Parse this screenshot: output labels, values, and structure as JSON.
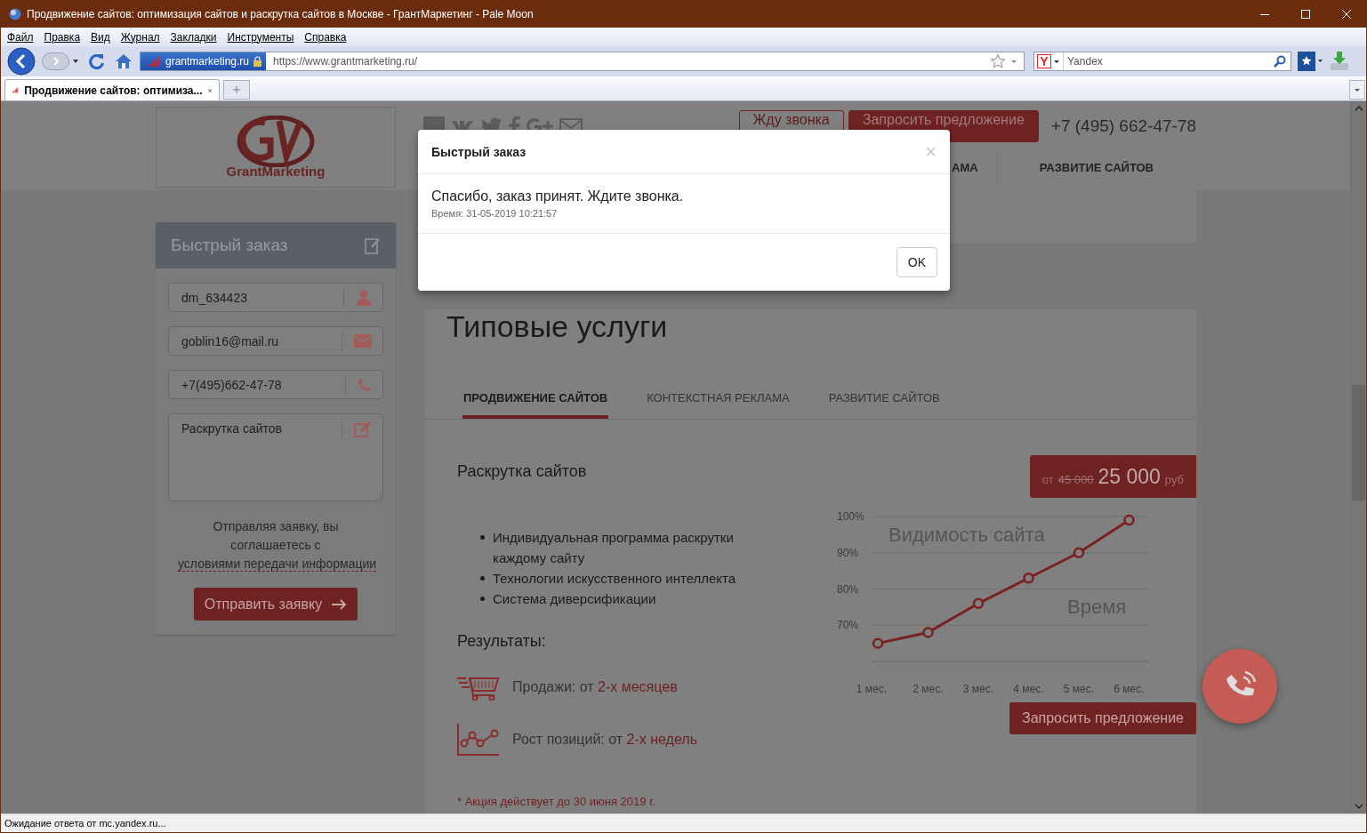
{
  "window": {
    "title": "Продвижение сайтов: оптимизация сайтов и раскрутка сайтов в Москве - ГрантМаркетинг - Pale Moon"
  },
  "menu": [
    "Файл",
    "Правка",
    "Вид",
    "Журнал",
    "Закладки",
    "Инструменты",
    "Справка"
  ],
  "navbar": {
    "identity": "grantmarketing.ru",
    "url": "https://www.grantmarketing.ru/",
    "search": {
      "placeholder": "Yandex"
    }
  },
  "tabs": [
    {
      "label": "Продвижение сайтов: оптимиза...",
      "selected": true
    }
  ],
  "header": {
    "buttons": [
      {
        "label": "Жду звонка",
        "kind": "outline"
      },
      {
        "label": "Запросить предложение",
        "kind": "filled"
      }
    ],
    "phone": "+7 (495) 662-47-78",
    "nav": [
      "АМА",
      "РАЗВИТИЕ САЙТОВ"
    ]
  },
  "logo": {
    "text": "GrantMarketing"
  },
  "order_form": {
    "title": "Быстрый заказ",
    "fields": [
      {
        "kind": "user",
        "value": "dm_634423"
      },
      {
        "kind": "mail",
        "value": "goblin16@mail.ru"
      },
      {
        "kind": "phone",
        "value": "+7(495)662-47-78"
      },
      {
        "kind": "note",
        "value": "Раскрутка сайтов"
      }
    ],
    "consent": "Отправляя заявку, вы соглашаетесь с",
    "consent_link": "условиями передачи информации",
    "submit": "Отправить заявку"
  },
  "services": {
    "title": "Типовые услуги",
    "tabs": [
      {
        "label": "ПРОДВИЖЕНИЕ САЙТОВ",
        "selected": true
      },
      {
        "label": "КОНТЕКСТНАЯ РЕКЛАМА",
        "selected": false
      },
      {
        "label": "РАЗВИТИЕ САЙТОВ",
        "selected": false
      }
    ],
    "name": "Раскрутка сайтов",
    "price": {
      "prefix": "от",
      "old": "45 000",
      "new": "25 000",
      "unit": "руб"
    },
    "features": [
      "Индивидуальная программа раскрутки каждому сайту",
      "Технологии искусственного интеллекта",
      "Система диверсификации"
    ],
    "results_title": "Результаты:",
    "results": [
      {
        "kind": "cart",
        "label": "Продажи: от",
        "value": "2-х месяцев"
      },
      {
        "kind": "growth",
        "label": "Рост позиций: от",
        "value": "2-х недель"
      }
    ],
    "note": "* Акция действует до 30 июня 2019 г.",
    "chart_data": {
      "type": "line",
      "ylabel": "Видимость сайта",
      "xlabel": "Время",
      "categories": [
        "1 мес.",
        "2 мес.",
        "3 мес.",
        "4 мес.",
        "5 мес.",
        "6 мес."
      ],
      "series": [
        {
          "color": "#7a2020",
          "marker": "circle",
          "values": [
            65,
            68,
            76,
            83,
            90,
            99
          ]
        }
      ],
      "grid": true,
      "ylim": [
        60,
        100
      ],
      "yticks": [
        {
          "value": 70,
          "label": "70%"
        },
        {
          "value": 80,
          "label": "80%"
        },
        {
          "value": 90,
          "label": "90%"
        },
        {
          "value": 100,
          "label": "100%"
        }
      ]
    },
    "button": "Запросить предложение"
  },
  "modal": {
    "title": "Быстрый заказ",
    "close": "×",
    "message": "Спасибо, заказ принят. Ждите звонка.",
    "time": "Время: 31-05-2019 10:21:57",
    "ok": "OK"
  },
  "status_bar": "Ожидание ответа от mc.yandex.ru..."
}
